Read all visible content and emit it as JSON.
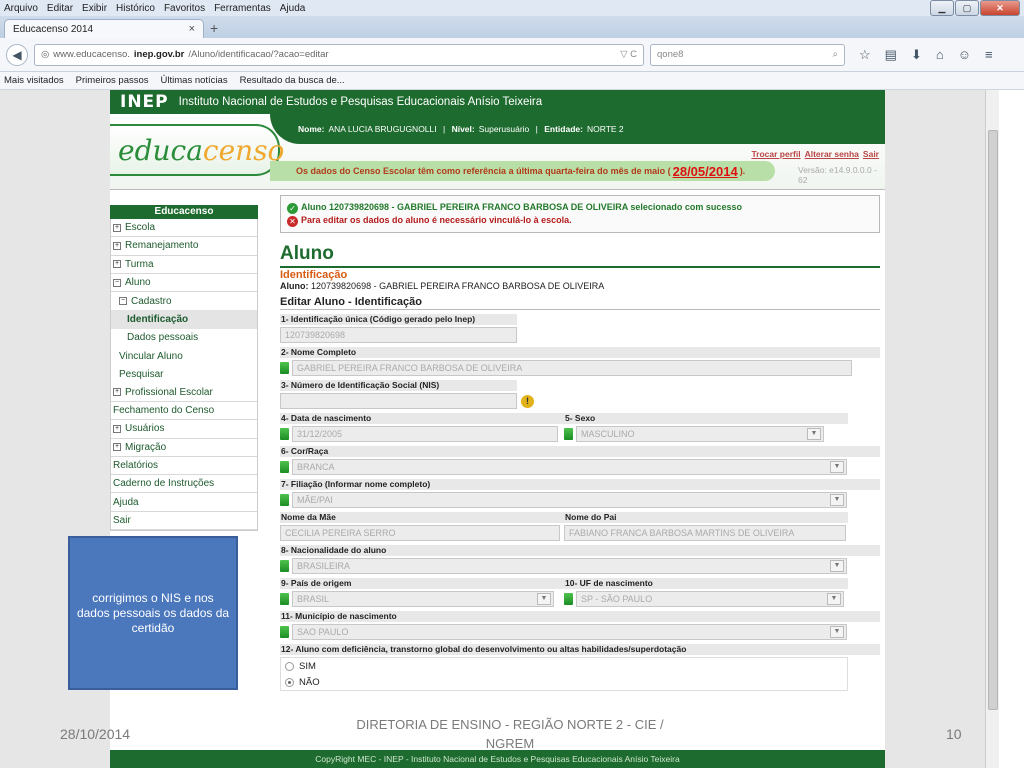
{
  "browser": {
    "menu": [
      "Arquivo",
      "Editar",
      "Exibir",
      "Histórico",
      "Favoritos",
      "Ferramentas",
      "Ajuda"
    ],
    "tab_title": "Educacenso 2014",
    "url_prefix": "www.educacenso.",
    "url_domain": "inep.gov.br",
    "url_path": "/Aluno/identificacao/?acao=editar",
    "search_placeholder": "qone8",
    "bookmarks": [
      "Mais visitados",
      "Primeiros passos",
      "Últimas notícias",
      "Resultado da busca de..."
    ]
  },
  "inep": {
    "logo": "INEP",
    "name": "Instituto Nacional de Estudos e Pesquisas Educacionais Anísio Teixeira"
  },
  "header": {
    "logo_part1": "educa",
    "logo_part2": "censo",
    "nome_label": "Nome:",
    "nome_value": "ANA LUCIA BRUGUGNOLLI",
    "nivel_label": "Nível:",
    "nivel_value": "Superusuário",
    "entidade_label": "Entidade:",
    "entidade_value": "NORTE 2",
    "links": [
      "Trocar perfil",
      "Alterar senha",
      "Sair"
    ],
    "notice": "Os dados do Censo Escolar têm como referência a última quarta-feira do mês de maio (",
    "notice_date": "28/05/2014",
    "notice_end": ").",
    "version": "Versão: e14.9.0.0.0 - 62"
  },
  "sidebar": {
    "title": "Educacenso",
    "items": [
      {
        "label": "Escola",
        "kind": "top",
        "exp": "+"
      },
      {
        "label": "Remanejamento",
        "kind": "top",
        "exp": "+"
      },
      {
        "label": "Turma",
        "kind": "top",
        "exp": "+"
      },
      {
        "label": "Aluno",
        "kind": "top",
        "exp": "−"
      },
      {
        "label": "Cadastro",
        "kind": "sub",
        "exp": "−"
      },
      {
        "label": "Identificação",
        "kind": "sub2",
        "active": true
      },
      {
        "label": "Dados pessoais",
        "kind": "sub2"
      },
      {
        "label": "Vincular Aluno",
        "kind": "sub"
      },
      {
        "label": "Pesquisar",
        "kind": "sub"
      },
      {
        "label": "Profissional Escolar",
        "kind": "top",
        "exp": "+"
      },
      {
        "label": "Fechamento do Censo",
        "kind": "top"
      },
      {
        "label": "Usuários",
        "kind": "top",
        "exp": "+"
      },
      {
        "label": "Migração",
        "kind": "top",
        "exp": "+"
      },
      {
        "label": "Relatórios",
        "kind": "top"
      },
      {
        "label": "Caderno de Instruções",
        "kind": "top"
      },
      {
        "label": "Ajuda",
        "kind": "top"
      },
      {
        "label": "Sair",
        "kind": "top"
      }
    ]
  },
  "messages": {
    "success": "Aluno 120739820698 - GABRIEL PEREIRA FRANCO BARBOSA DE OLIVEIRA selecionado com sucesso",
    "error": "Para editar os dados do aluno é necessário vinculá-lo à escola."
  },
  "form": {
    "title": "Aluno",
    "subtitle": "Identificação",
    "aluno_label": "Aluno:",
    "aluno_value": "120739820698 - GABRIEL PEREIRA FRANCO BARBOSA DE OLIVEIRA",
    "section": "Editar Aluno - Identificação",
    "f1_label": "1- Identificação única (Código gerado pelo Inep)",
    "f1_value": "120739820698",
    "f2_label": "2- Nome Completo",
    "f2_value": "GABRIEL PEREIRA FRANCO BARBOSA DE OLIVEIRA",
    "f3_label": "3- Número de Identificação Social (NIS)",
    "f3_value": "",
    "f4_label": "4- Data de nascimento",
    "f4_value": "31/12/2005",
    "f5_label": "5- Sexo",
    "f5_value": "MASCULINO",
    "f6_label": "6- Cor/Raça",
    "f6_value": "BRANCA",
    "f7_label": "7- Filiação (Informar nome completo)",
    "f7_value": "MÃE/PAI",
    "mae_label": "Nome da Mãe",
    "mae_value": "CECILIA PEREIRA SERRO",
    "pai_label": "Nome do Pai",
    "pai_value": "FABIANO FRANCA BARBOSA MARTINS DE OLIVEIRA",
    "f8_label": "8- Nacionalidade do aluno",
    "f8_value": "BRASILEIRA",
    "f9_label": "9- País de origem",
    "f9_value": "BRASIL",
    "f10_label": "10- UF de nascimento",
    "f10_value": "SP - SÃO PAULO",
    "f11_label": "11- Município de nascimento",
    "f11_value": "SAO PAULO",
    "f12_label": "12- Aluno com deficiência, transtorno global do desenvolvimento ou altas habilidades/superdotação",
    "f12_options": [
      "SIM",
      "NÃO"
    ]
  },
  "footer": "CopyRight MEC - INEP - Instituto Nacional de Estudos e Pesquisas Educacionais Anísio Teixeira",
  "slide": {
    "annotation": "corrigimos o NIS  e nos dados pessoais os dados da certidão",
    "date": "28/10/2014",
    "footer": "DIRETORIA DE ENSINO - REGIÃO NORTE 2 - CIE / NGREM",
    "number": "10"
  }
}
